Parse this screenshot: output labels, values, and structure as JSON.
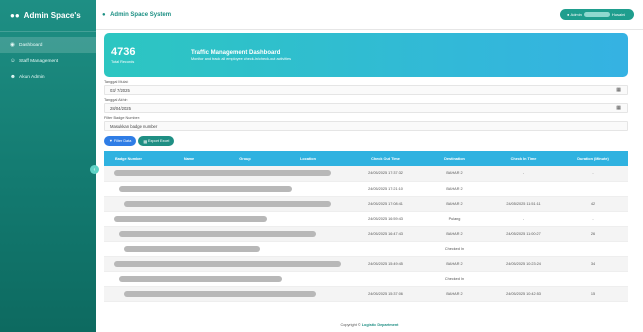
{
  "sidebar": {
    "brand": "Admin Space's",
    "items": [
      {
        "icon": "dashboard-icon",
        "label": "Dashboard",
        "active": true
      },
      {
        "icon": "staff-icon",
        "label": "Staff Management",
        "active": false
      },
      {
        "icon": "users-icon",
        "label": "Akun Admin",
        "active": false
      }
    ]
  },
  "topbar": {
    "title": "Admin Space System",
    "user_prefix": "Admin",
    "user_suffix": "Husaini"
  },
  "hero": {
    "count": "4736",
    "count_caption": "Total Records",
    "title": "Traffic Management Dashboard",
    "subtitle": "Monitor and track all employee check-in/check-out activities"
  },
  "filters": {
    "start_label": "Tanggal Mulai:",
    "start_value": "03/ 7/2025",
    "end_label": "Tanggal Akhir:",
    "end_value": "28/04/2025",
    "badge_label": "Filter Badge Number:",
    "badge_placeholder": "Masukkan badge number",
    "filter_button": "Filter Data",
    "export_button": "Export Excel"
  },
  "table": {
    "headers": [
      "Badge Number",
      "Name",
      "Group",
      "Location",
      "Check Out Time",
      "Destination",
      "Check In Time",
      "Duration (Minute)"
    ],
    "rows": [
      {
        "out": "24/05/2025 17:37:32",
        "dest": "BAHAR 2",
        "in": "-",
        "dur": "-"
      },
      {
        "out": "24/05/2025 17:21:10",
        "dest": "BAHAR 2",
        "in": "",
        "dur": ""
      },
      {
        "out": "24/05/2025 17:08:41",
        "dest": "BAHAR 2",
        "in": "24/05/2025 11:51:11",
        "dur": "42"
      },
      {
        "out": "24/05/2025 16:59:43",
        "dest": "Pulang",
        "in": "-",
        "dur": "-"
      },
      {
        "out": "24/05/2025 16:47:43",
        "dest": "BAHAR 2",
        "in": "24/05/2025 11:00:27",
        "dur": "26"
      },
      {
        "out": "",
        "dest": "Checked In",
        "in": "",
        "dur": ""
      },
      {
        "out": "24/05/2025 15:49:45",
        "dest": "BAHAR 2",
        "in": "24/05/2025 10:23:24",
        "dur": "34"
      },
      {
        "out": "",
        "dest": "Checked In",
        "in": "",
        "dur": ""
      },
      {
        "out": "24/05/2025 15:37:06",
        "dest": "BAHAR 2",
        "in": "24/05/2025 10:42:53",
        "dur": "15"
      }
    ]
  },
  "footer": {
    "prefix": "Copyright ©",
    "brand": "Logistic Department"
  },
  "colors": {
    "sidebar": "#137a70",
    "accent": "#1f8f84",
    "table_header": "#2fb2e0",
    "hero_start": "#2cc6c1",
    "hero_end": "#35b2e3"
  }
}
